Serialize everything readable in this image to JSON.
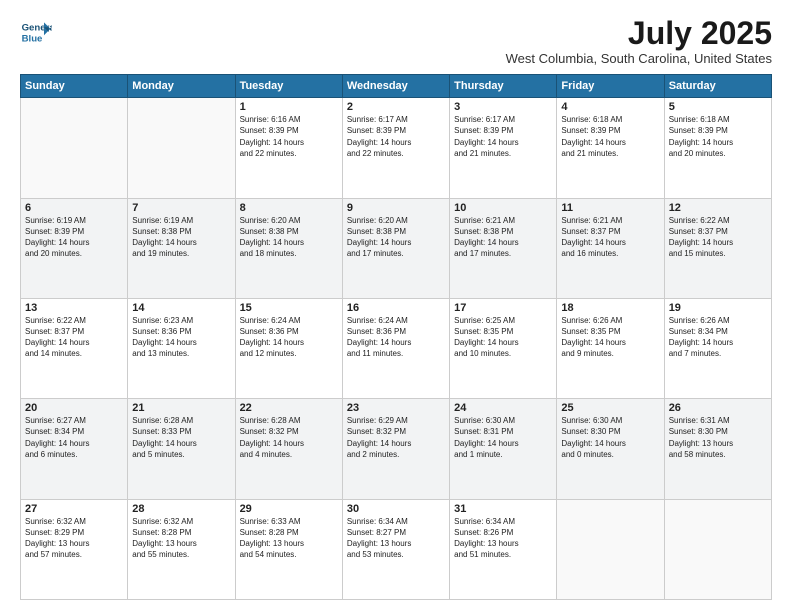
{
  "logo": {
    "line1": "General",
    "line2": "Blue"
  },
  "title": "July 2025",
  "subtitle": "West Columbia, South Carolina, United States",
  "days_header": [
    "Sunday",
    "Monday",
    "Tuesday",
    "Wednesday",
    "Thursday",
    "Friday",
    "Saturday"
  ],
  "weeks": [
    [
      {
        "day": "",
        "info": ""
      },
      {
        "day": "",
        "info": ""
      },
      {
        "day": "1",
        "info": "Sunrise: 6:16 AM\nSunset: 8:39 PM\nDaylight: 14 hours\nand 22 minutes."
      },
      {
        "day": "2",
        "info": "Sunrise: 6:17 AM\nSunset: 8:39 PM\nDaylight: 14 hours\nand 22 minutes."
      },
      {
        "day": "3",
        "info": "Sunrise: 6:17 AM\nSunset: 8:39 PM\nDaylight: 14 hours\nand 21 minutes."
      },
      {
        "day": "4",
        "info": "Sunrise: 6:18 AM\nSunset: 8:39 PM\nDaylight: 14 hours\nand 21 minutes."
      },
      {
        "day": "5",
        "info": "Sunrise: 6:18 AM\nSunset: 8:39 PM\nDaylight: 14 hours\nand 20 minutes."
      }
    ],
    [
      {
        "day": "6",
        "info": "Sunrise: 6:19 AM\nSunset: 8:39 PM\nDaylight: 14 hours\nand 20 minutes."
      },
      {
        "day": "7",
        "info": "Sunrise: 6:19 AM\nSunset: 8:38 PM\nDaylight: 14 hours\nand 19 minutes."
      },
      {
        "day": "8",
        "info": "Sunrise: 6:20 AM\nSunset: 8:38 PM\nDaylight: 14 hours\nand 18 minutes."
      },
      {
        "day": "9",
        "info": "Sunrise: 6:20 AM\nSunset: 8:38 PM\nDaylight: 14 hours\nand 17 minutes."
      },
      {
        "day": "10",
        "info": "Sunrise: 6:21 AM\nSunset: 8:38 PM\nDaylight: 14 hours\nand 17 minutes."
      },
      {
        "day": "11",
        "info": "Sunrise: 6:21 AM\nSunset: 8:37 PM\nDaylight: 14 hours\nand 16 minutes."
      },
      {
        "day": "12",
        "info": "Sunrise: 6:22 AM\nSunset: 8:37 PM\nDaylight: 14 hours\nand 15 minutes."
      }
    ],
    [
      {
        "day": "13",
        "info": "Sunrise: 6:22 AM\nSunset: 8:37 PM\nDaylight: 14 hours\nand 14 minutes."
      },
      {
        "day": "14",
        "info": "Sunrise: 6:23 AM\nSunset: 8:36 PM\nDaylight: 14 hours\nand 13 minutes."
      },
      {
        "day": "15",
        "info": "Sunrise: 6:24 AM\nSunset: 8:36 PM\nDaylight: 14 hours\nand 12 minutes."
      },
      {
        "day": "16",
        "info": "Sunrise: 6:24 AM\nSunset: 8:36 PM\nDaylight: 14 hours\nand 11 minutes."
      },
      {
        "day": "17",
        "info": "Sunrise: 6:25 AM\nSunset: 8:35 PM\nDaylight: 14 hours\nand 10 minutes."
      },
      {
        "day": "18",
        "info": "Sunrise: 6:26 AM\nSunset: 8:35 PM\nDaylight: 14 hours\nand 9 minutes."
      },
      {
        "day": "19",
        "info": "Sunrise: 6:26 AM\nSunset: 8:34 PM\nDaylight: 14 hours\nand 7 minutes."
      }
    ],
    [
      {
        "day": "20",
        "info": "Sunrise: 6:27 AM\nSunset: 8:34 PM\nDaylight: 14 hours\nand 6 minutes."
      },
      {
        "day": "21",
        "info": "Sunrise: 6:28 AM\nSunset: 8:33 PM\nDaylight: 14 hours\nand 5 minutes."
      },
      {
        "day": "22",
        "info": "Sunrise: 6:28 AM\nSunset: 8:32 PM\nDaylight: 14 hours\nand 4 minutes."
      },
      {
        "day": "23",
        "info": "Sunrise: 6:29 AM\nSunset: 8:32 PM\nDaylight: 14 hours\nand 2 minutes."
      },
      {
        "day": "24",
        "info": "Sunrise: 6:30 AM\nSunset: 8:31 PM\nDaylight: 14 hours\nand 1 minute."
      },
      {
        "day": "25",
        "info": "Sunrise: 6:30 AM\nSunset: 8:30 PM\nDaylight: 14 hours\nand 0 minutes."
      },
      {
        "day": "26",
        "info": "Sunrise: 6:31 AM\nSunset: 8:30 PM\nDaylight: 13 hours\nand 58 minutes."
      }
    ],
    [
      {
        "day": "27",
        "info": "Sunrise: 6:32 AM\nSunset: 8:29 PM\nDaylight: 13 hours\nand 57 minutes."
      },
      {
        "day": "28",
        "info": "Sunrise: 6:32 AM\nSunset: 8:28 PM\nDaylight: 13 hours\nand 55 minutes."
      },
      {
        "day": "29",
        "info": "Sunrise: 6:33 AM\nSunset: 8:28 PM\nDaylight: 13 hours\nand 54 minutes."
      },
      {
        "day": "30",
        "info": "Sunrise: 6:34 AM\nSunset: 8:27 PM\nDaylight: 13 hours\nand 53 minutes."
      },
      {
        "day": "31",
        "info": "Sunrise: 6:34 AM\nSunset: 8:26 PM\nDaylight: 13 hours\nand 51 minutes."
      },
      {
        "day": "",
        "info": ""
      },
      {
        "day": "",
        "info": ""
      }
    ]
  ]
}
